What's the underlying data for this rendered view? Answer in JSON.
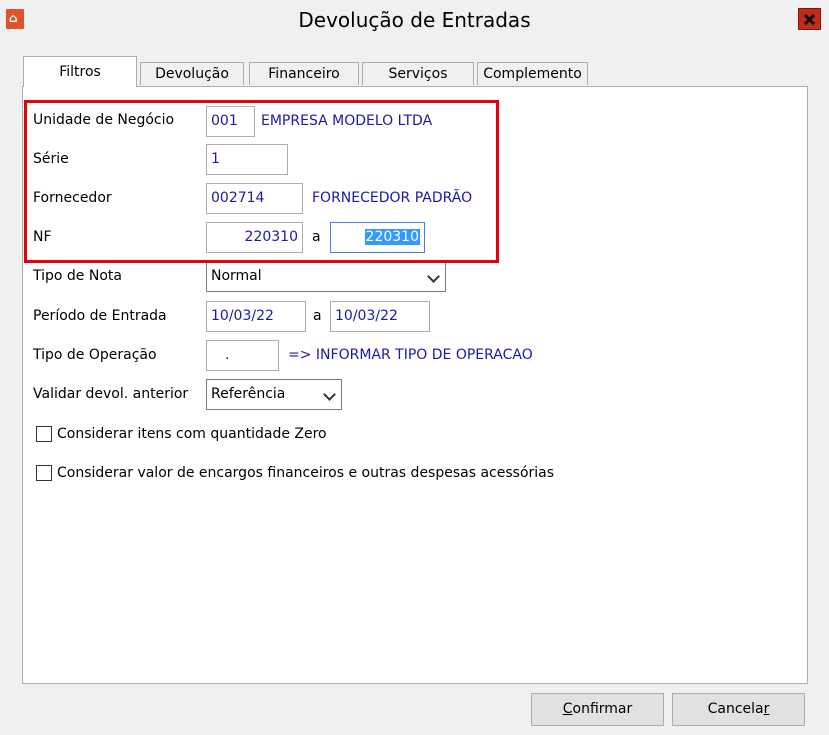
{
  "window": {
    "title": "Devolução de Entradas",
    "icon": "app-logo-icon",
    "close_icon": "close-icon"
  },
  "tabs": [
    {
      "label": "Filtros",
      "active": true
    },
    {
      "label": "Devolução",
      "active": false
    },
    {
      "label": "Financeiro",
      "active": false
    },
    {
      "label": "Serviços",
      "active": false
    },
    {
      "label": "Complemento",
      "active": false
    }
  ],
  "form": {
    "unidade": {
      "label": "Unidade de Negócio",
      "code": "001",
      "name": "EMPRESA MODELO LTDA"
    },
    "serie": {
      "label": "Série",
      "value": "1"
    },
    "fornecedor": {
      "label": "Fornecedor",
      "code": "002714",
      "name": "FORNECEDOR PADRÃO"
    },
    "nf": {
      "label": "NF",
      "from": "220310",
      "sep": "a",
      "to": "220310"
    },
    "tipo_nota": {
      "label": "Tipo de Nota",
      "value": "Normal"
    },
    "periodo": {
      "label": "Período de Entrada",
      "from": "10/03/22",
      "sep": "a",
      "to": "10/03/22"
    },
    "tipo_operacao": {
      "label": "Tipo de Operação",
      "value": ".",
      "hint": "=> INFORMAR TIPO DE OPERACAO"
    },
    "validar": {
      "label": "Validar devol. anterior",
      "value": "Referência"
    },
    "chk_zero": {
      "label": "Considerar itens com quantidade Zero",
      "checked": false
    },
    "chk_encargos": {
      "label": "Considerar valor de encargos financeiros e outras despesas acessórias",
      "checked": false
    }
  },
  "buttons": {
    "confirm": {
      "prefix": "",
      "accel": "C",
      "rest": "onfirmar"
    },
    "cancel": {
      "prefix": "Cancela",
      "accel": "r",
      "rest": ""
    }
  },
  "colors": {
    "highlight": "#e3000f",
    "value_text": "#1a1aa8",
    "selection": "#3399ff",
    "close_button": "#c42b1c"
  }
}
